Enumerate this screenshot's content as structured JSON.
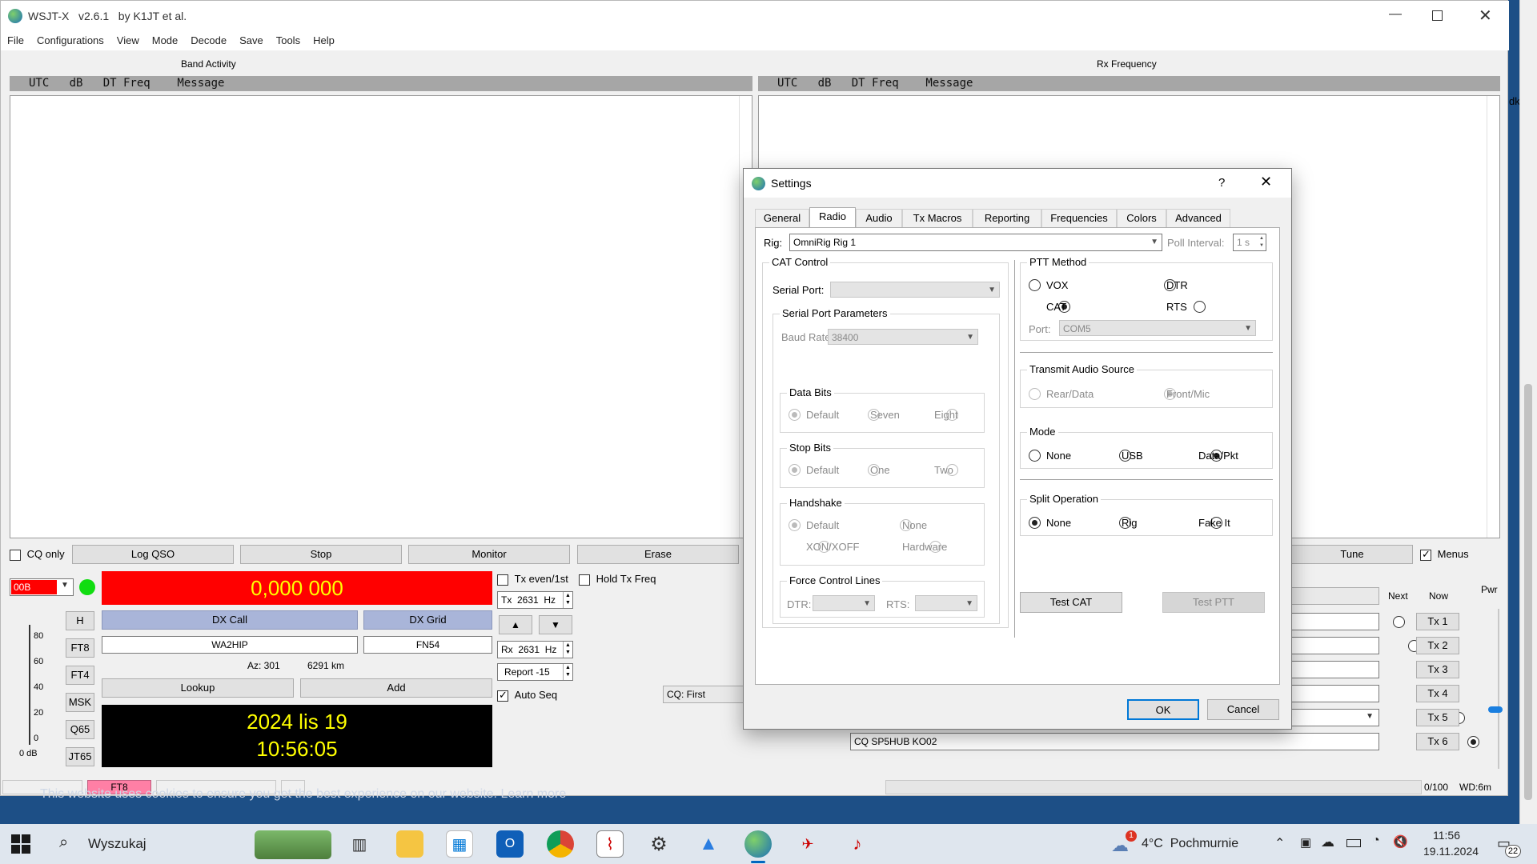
{
  "app": {
    "title": "WSJT-X   v2.6.1   by K1JT et al.",
    "menu": [
      "File",
      "Configurations",
      "View",
      "Mode",
      "Decode",
      "Save",
      "Tools",
      "Help"
    ]
  },
  "band_activity": {
    "title": "Band Activity",
    "header": "UTC   dB   DT Freq    Message"
  },
  "rx_frequency": {
    "title": "Rx Frequency",
    "header": "UTC   dB   DT Freq    Message",
    "side_fragment": "dki"
  },
  "controls": {
    "cq_only": "CQ only",
    "log_qso": "Log QSO",
    "stop": "Stop",
    "monitor": "Monitor",
    "erase": "Erase",
    "tune": "Tune",
    "menus": "Menus",
    "band": "00B",
    "frequency": "0,000 000",
    "tx_even": "Tx even/1st",
    "hold_tx_freq": "Hold Tx Freq",
    "tx_freq": "Tx  2631  Hz",
    "rx_freq": "Rx  2631  Hz",
    "report": "Report -15",
    "auto_seq": "Auto Seq",
    "cq_first": "CQ: First",
    "dx_call_label": "DX Call",
    "dx_grid_label": "DX Grid",
    "dx_call": "WA2HIP",
    "dx_grid": "FN54",
    "az": "Az: 301",
    "distance": "6291 km",
    "lookup": "Lookup",
    "add": "Add",
    "date": "2024 lis 19",
    "time": "10:56:05",
    "mode_buttons": [
      "H",
      "FT8",
      "FT4",
      "MSK",
      "Q65",
      "JT65"
    ],
    "meter_ticks": [
      "80",
      "60",
      "40",
      "20",
      "0"
    ],
    "meter_unit": "0 dB",
    "next": "Next",
    "now": "Now",
    "pwr": "Pwr",
    "tx_buttons": [
      "Tx 1",
      "Tx 2",
      "Tx 3",
      "Tx 4",
      "Tx 5",
      "Tx 6"
    ],
    "tx6_message": "CQ SP5HUB KO02"
  },
  "statusbar": {
    "mode": "FT8",
    "progress": "0/100",
    "wd": "WD:6m"
  },
  "background_text": "This website uses cookies to ensure you get the best experience on our website. Learn more",
  "settings": {
    "title": "Settings",
    "help": "?",
    "tabs": [
      "General",
      "Radio",
      "Audio",
      "Tx Macros",
      "Reporting",
      "Frequencies",
      "Colors",
      "Advanced"
    ],
    "rig_label": "Rig:",
    "rig_value": "OmniRig Rig 1",
    "poll_label": "Poll Interval:",
    "poll_value": "1 s",
    "cat_control": "CAT Control",
    "serial_port": "Serial Port:",
    "serial_params": "Serial Port Parameters",
    "baud_label": "Baud Rate:",
    "baud_value": "38400",
    "data_bits": "Data Bits",
    "data_bits_opts": [
      "Default",
      "Seven",
      "Eight"
    ],
    "stop_bits": "Stop Bits",
    "stop_bits_opts": [
      "Default",
      "One",
      "Two"
    ],
    "handshake": "Handshake",
    "handshake_opts": [
      "Default",
      "None",
      "XON/XOFF",
      "Hardware"
    ],
    "force_lines": "Force Control Lines",
    "dtr": "DTR:",
    "rts": "RTS:",
    "ptt_method": "PTT Method",
    "ptt_opts": [
      "VOX",
      "DTR",
      "CAT",
      "RTS"
    ],
    "port_label": "Port:",
    "port_value": "COM5",
    "audio_source": "Transmit Audio Source",
    "audio_opts": [
      "Rear/Data",
      "Front/Mic"
    ],
    "mode": "Mode",
    "mode_opts": [
      "None",
      "USB",
      "Data/Pkt"
    ],
    "split": "Split Operation",
    "split_opts": [
      "None",
      "Rig",
      "Fake It"
    ],
    "test_cat": "Test CAT",
    "test_ptt": "Test PTT",
    "ok": "OK",
    "cancel": "Cancel"
  },
  "taskbar": {
    "search": "Wyszukaj",
    "weather": "4°C  Pochmurnie",
    "time": "11:56",
    "date": "19.11.2024",
    "notif_count": "22",
    "weather_badge": "1"
  }
}
